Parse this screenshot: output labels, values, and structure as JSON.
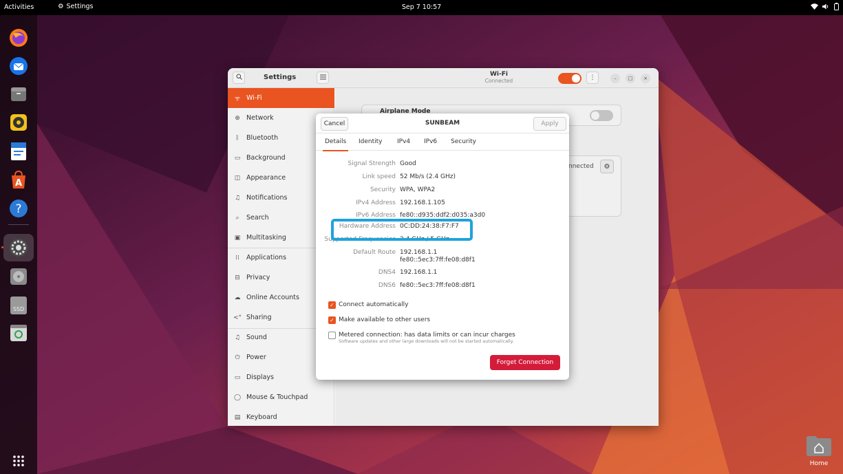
{
  "topbar": {
    "activities": "Activities",
    "app_name": "Settings",
    "clock": "Sep 7  10:57"
  },
  "desktop": {
    "home_label": "Home"
  },
  "window": {
    "sidebar_title": "Settings",
    "main_title": "Wi-Fi",
    "main_subtitle": "Connected",
    "airplane_label": "Airplane Mode",
    "network_status": "nnected"
  },
  "sidebar": {
    "items": [
      {
        "label": "Wi-Fi",
        "icon": "wifi-icon",
        "glyph": "ᯤ",
        "active": true
      },
      {
        "label": "Network",
        "icon": "network-icon",
        "glyph": "⊕"
      },
      {
        "label": "Bluetooth",
        "icon": "bluetooth-icon",
        "glyph": "ᛒ"
      },
      {
        "label": "Background",
        "icon": "background-icon",
        "glyph": "▭"
      },
      {
        "label": "Appearance",
        "icon": "appearance-icon",
        "glyph": "◫"
      },
      {
        "label": "Notifications",
        "icon": "bell-icon",
        "glyph": "♫"
      },
      {
        "label": "Search",
        "icon": "search-icon",
        "glyph": "⌕"
      },
      {
        "label": "Multitasking",
        "icon": "multitasking-icon",
        "glyph": "▣"
      },
      {
        "label": "Applications",
        "icon": "applications-icon",
        "glyph": "⁞⁞"
      },
      {
        "label": "Privacy",
        "icon": "lock-icon",
        "glyph": "⊟"
      },
      {
        "label": "Online Accounts",
        "icon": "cloud-icon",
        "glyph": "☁"
      },
      {
        "label": "Sharing",
        "icon": "share-icon",
        "glyph": "<°"
      },
      {
        "label": "Sound",
        "icon": "music-note-icon",
        "glyph": "♫"
      },
      {
        "label": "Power",
        "icon": "power-icon",
        "glyph": "⏻"
      },
      {
        "label": "Displays",
        "icon": "display-icon",
        "glyph": "▭"
      },
      {
        "label": "Mouse & Touchpad",
        "icon": "mouse-icon",
        "glyph": "◯"
      },
      {
        "label": "Keyboard",
        "icon": "keyboard-icon",
        "glyph": "▤"
      }
    ]
  },
  "dialog": {
    "cancel_label": "Cancel",
    "title": "SUNBEAM",
    "apply_label": "Apply",
    "tabs": [
      "Details",
      "Identity",
      "IPv4",
      "IPv6",
      "Security"
    ],
    "active_tab": "Details",
    "properties": [
      {
        "label": "Signal Strength",
        "value": "Good"
      },
      {
        "label": "Link speed",
        "value": "52 Mb/s (2.4 GHz)"
      },
      {
        "label": "Security",
        "value": "WPA, WPA2"
      },
      {
        "label": "IPv4 Address",
        "value": "192.168.1.105"
      },
      {
        "label": "IPv6 Address",
        "value": "fe80::d935:ddf2:d035:a3d0"
      },
      {
        "label": "Hardware Address",
        "value": "0C:DD:24:38:F7:F7"
      },
      {
        "label": "Supported Frequencies",
        "value": "2.4 GHz / 5 GHz"
      },
      {
        "label": "Default Route",
        "value": "192.168.1.1",
        "value2": "fe80::5ec3:7ff:fe08:d8f1"
      },
      {
        "label": "DNS4",
        "value": "192.168.1.1"
      },
      {
        "label": "DNS6",
        "value": "fe80::5ec3:7ff:fe08:d8f1"
      }
    ],
    "checks": [
      {
        "label": "Connect automatically",
        "checked": true
      },
      {
        "label": "Make available to other users",
        "checked": true
      },
      {
        "label": "Metered connection: has data limits or can incur charges",
        "sub": "Software updates and other large downloads will not be started automatically.",
        "checked": false
      }
    ],
    "forget_label": "Forget Connection"
  },
  "colors": {
    "accent": "#e95420",
    "destructive": "#d41c3a",
    "highlight": "#1ea3dc"
  }
}
